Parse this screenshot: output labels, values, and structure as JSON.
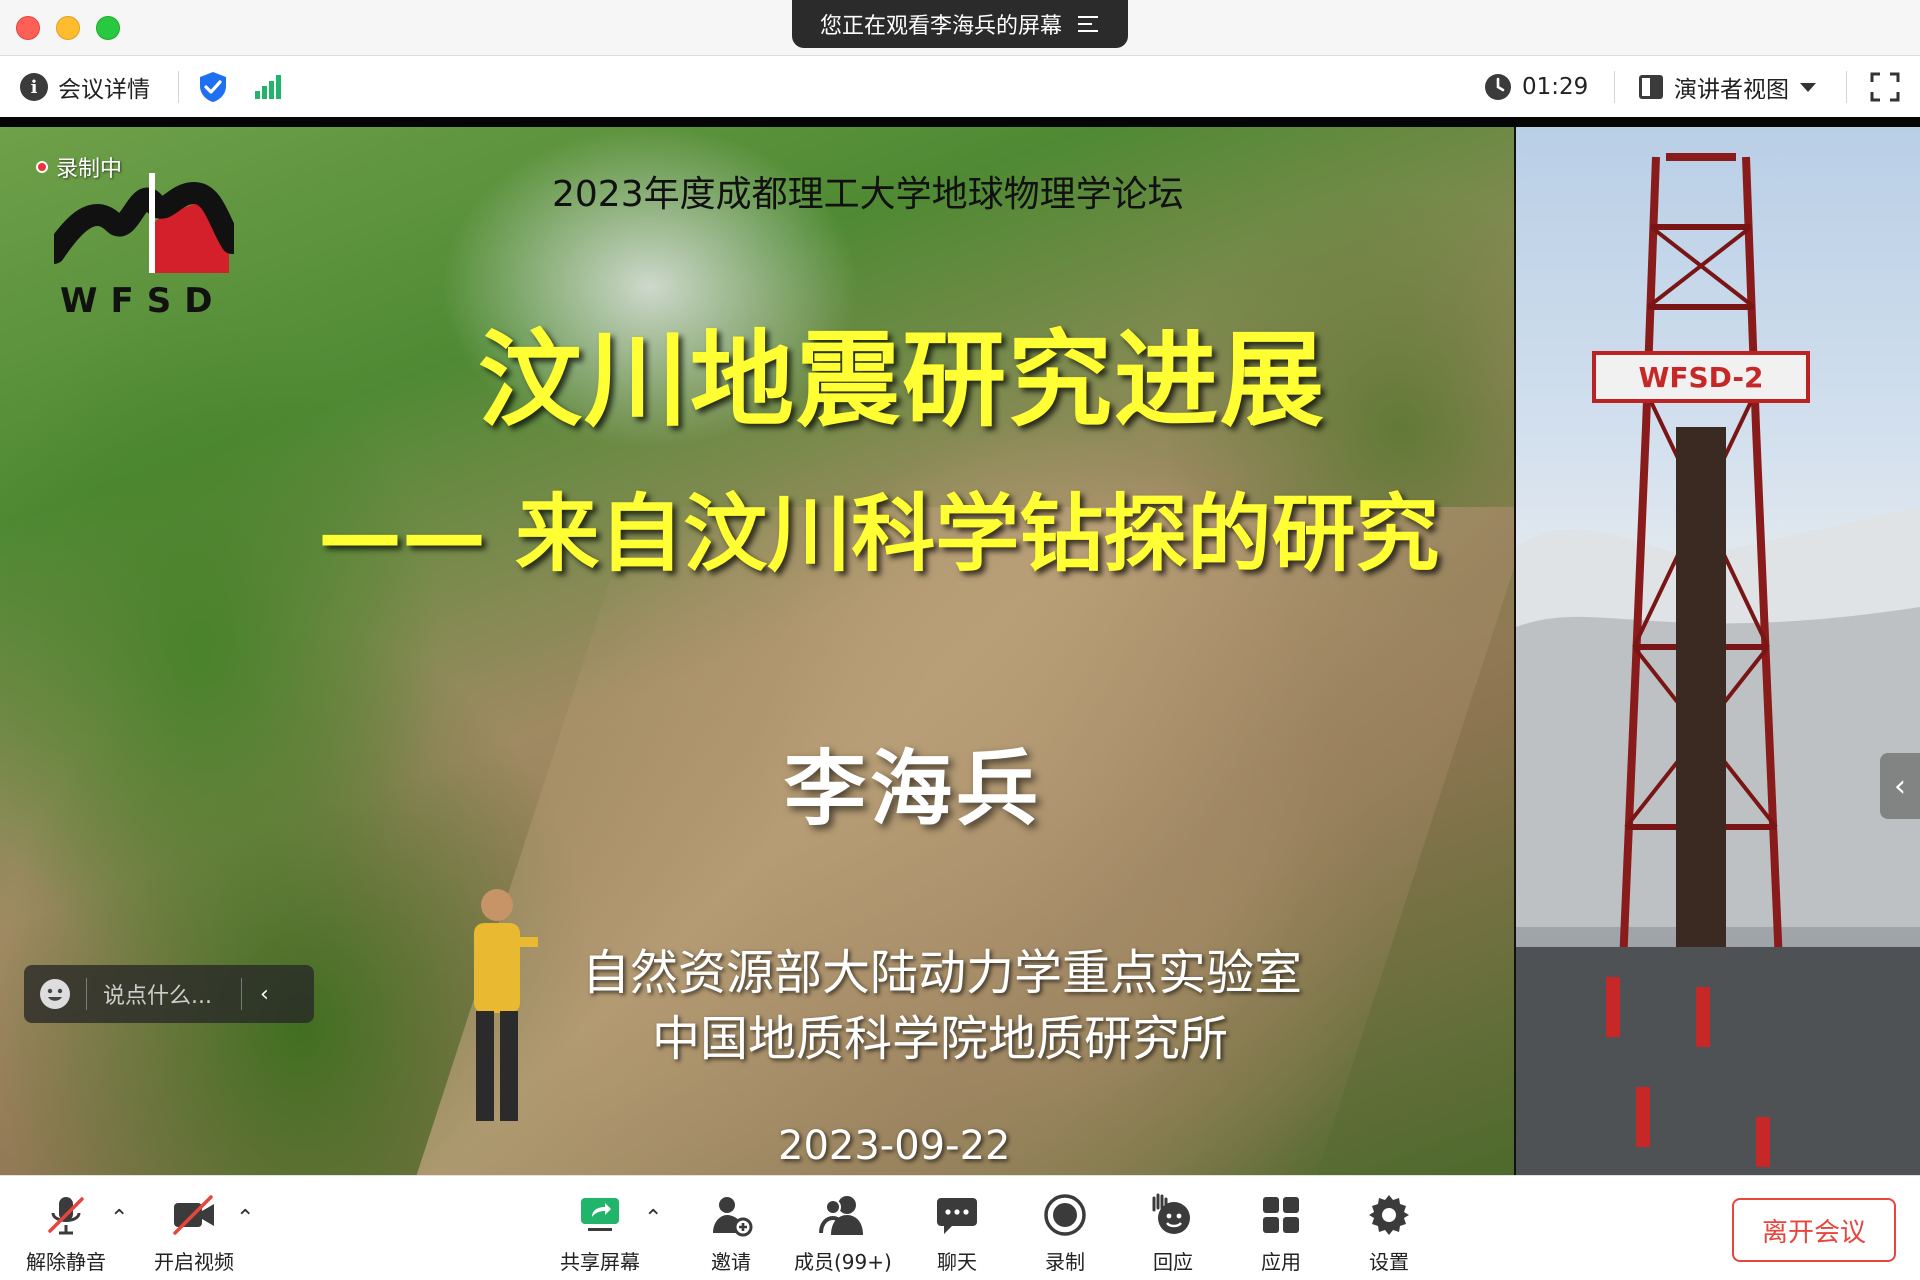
{
  "window": {
    "share_banner": "您正在观看李海兵的屏幕"
  },
  "infobar": {
    "meeting_info": "会议详情",
    "timer": "01:29",
    "view_mode": "演讲者视图"
  },
  "stage": {
    "recording_label": "录制中",
    "chat_placeholder": "说点什么...",
    "slide": {
      "forum": "2023年度成都理工大学地球物理学论坛",
      "title": "汶川地震研究进展",
      "subtitle": "—— 来自汶川科学钻探的研究",
      "speaker": "李海兵",
      "institution_1": "自然资源部大陆动力学重点实验室",
      "institution_2": "中国地质科学院地质研究所",
      "date": "2023-09-22",
      "logo_text": "WFSD"
    },
    "rig_photo_label": "WFSD-2"
  },
  "toolbar": {
    "unmute": "解除静音",
    "start_video": "开启视频",
    "share_screen": "共享屏幕",
    "invite": "邀请",
    "members": "成员(99+)",
    "chat": "聊天",
    "record": "录制",
    "react": "回应",
    "apps": "应用",
    "settings": "设置",
    "leave": "离开会议"
  },
  "colors": {
    "accent_green": "#21b46a",
    "leave_red": "#e8453c",
    "shield_blue": "#1f6ff2",
    "title_yellow": "#ffff33"
  }
}
